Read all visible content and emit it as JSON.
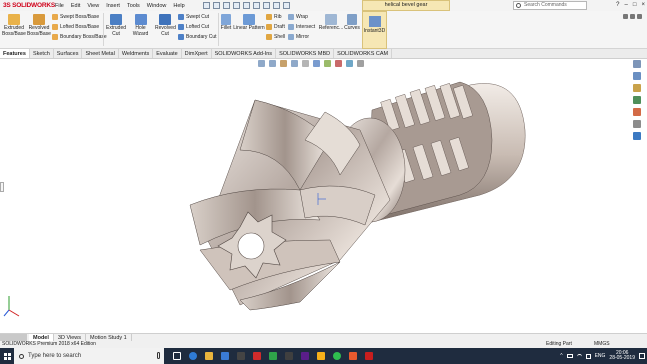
{
  "app": {
    "logo_prefix": "3S",
    "logo_text": "SOLIDWORKS",
    "menu": [
      "File",
      "Edit",
      "View",
      "Insert",
      "Tools",
      "Window",
      "Help"
    ],
    "document_title": "helical bevel gear",
    "search_placeholder": "Search Commands",
    "window_controls": [
      "?",
      "–",
      "□",
      "×"
    ]
  },
  "ribbon": {
    "extruded_boss": "Extruded Boss/Base",
    "revolved_boss": "Revolved Boss/Base",
    "swept_boss": "Swept Boss/Base",
    "lofted_boss": "Lofted Boss/Base",
    "boundary_boss": "Boundary Boss/Base",
    "extruded_cut": "Extruded Cut",
    "hole_wizard": "Hole Wizard",
    "revolved_cut": "Revolved Cut",
    "swept_cut": "Swept Cut",
    "lofted_cut": "Lofted Cut",
    "boundary_cut": "Boundary Cut",
    "fillet": "Fillet",
    "linear_pattern": "Linear Pattern",
    "rib": "Rib",
    "draft": "Draft",
    "shell": "Shell",
    "wrap": "Wrap",
    "intersect": "Intersect",
    "mirror": "Mirror",
    "reference": "Referenc...",
    "curves": "Curves",
    "instant3d": "Instant3D"
  },
  "tabs": [
    "Features",
    "Sketch",
    "Surfaces",
    "Sheet Metal",
    "Weldments",
    "Evaluate",
    "DimXpert",
    "SOLIDWORKS Add-Ins",
    "SOLIDWORKS MBD",
    "SOLIDWORKS CAM"
  ],
  "bottom_tabs": [
    "Model",
    "3D Views",
    "Motion Study 1"
  ],
  "status": {
    "edition": "SOLIDWORKS Premium 2018 x64 Edition",
    "mode": "Editing Part",
    "units": "MMGS"
  },
  "taskbar": {
    "search_placeholder": "Type here to search",
    "language": "ENG",
    "time": "20:06",
    "date": "28-05-2019"
  },
  "colors": {
    "accent": "#d0021b",
    "instant3d_bg": "#f6e7b4",
    "taskbar_bg": "#1f2c3f"
  }
}
